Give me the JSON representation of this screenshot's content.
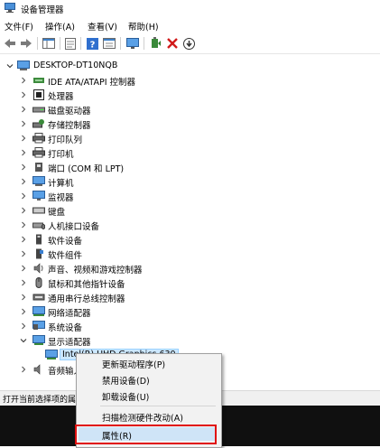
{
  "window": {
    "title": "设备管理器"
  },
  "menu": [
    "文件(F)",
    "操作(A)",
    "查看(V)",
    "帮助(H)"
  ],
  "tree": {
    "root": "DESKTOP-DT10NQB",
    "items": [
      "IDE ATA/ATAPI 控制器",
      "处理器",
      "磁盘驱动器",
      "存储控制器",
      "打印队列",
      "打印机",
      "端口 (COM 和 LPT)",
      "计算机",
      "监视器",
      "键盘",
      "人机接口设备",
      "软件设备",
      "软件组件",
      "声音、视频和游戏控制器",
      "鼠标和其他指针设备",
      "通用串行总线控制器",
      "网络适配器",
      "系统设备",
      "显示适配器"
    ],
    "child": "Intel(R) UHD Graphics 630",
    "after": "音频输入"
  },
  "status": {
    "text": "打开当前选择项的属"
  },
  "context_menu": {
    "items": [
      "更新驱动程序(P)",
      "禁用设备(D)",
      "卸载设备(U)",
      "扫描检测硬件改动(A)",
      "属性(R)"
    ]
  },
  "colors": {
    "selection": "#cce8ff",
    "highlight_box": "#e01010",
    "menu_hover": "#cfe4f7"
  }
}
